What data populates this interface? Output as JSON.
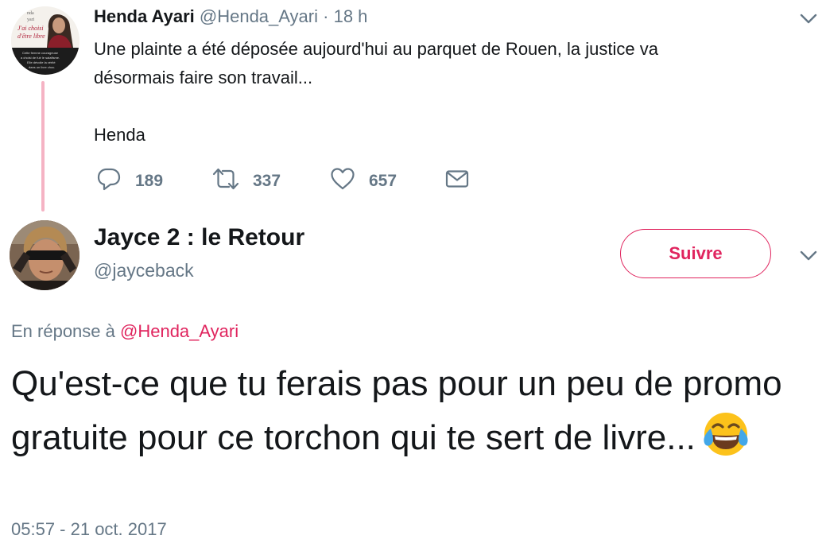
{
  "parent_tweet": {
    "avatar_text": [
      "nda",
      "yari",
      "J'ai choisi",
      "d'être libre",
      "Cette femme courageuse",
      "a choisi de fuir le salafisme.",
      "Elle dévoile la vérité",
      "dans un livre choc."
    ],
    "author_name": "Henda Ayari",
    "handle": "@Henda_Ayari",
    "separator": "·",
    "time": "18 h",
    "text_lines": [
      "Une plainte a été déposée aujourd'hui au parquet de Rouen, la justice va",
      "désormais faire son travail...",
      "",
      "Henda"
    ],
    "actions": {
      "reply_count": "189",
      "retweet_count": "337",
      "like_count": "657"
    }
  },
  "main_tweet": {
    "author_name": "Jayce 2 : le Retour",
    "handle": "@jayceback",
    "follow_label": "Suivre",
    "reply_prefix": "En réponse à",
    "reply_handle": "@Henda_Ayari",
    "text": "Qu'est-ce que tu ferais pas pour un peu de promo gratuite pour ce torchon qui te sert de livre...",
    "emoji_icon": "face-with-tears-of-joy-icon",
    "timestamp": "05:57 - 21 oct. 2017"
  },
  "colors": {
    "accent": "#e0245e",
    "secondary_text": "#657786",
    "thread_line": "#f5b3c4"
  }
}
